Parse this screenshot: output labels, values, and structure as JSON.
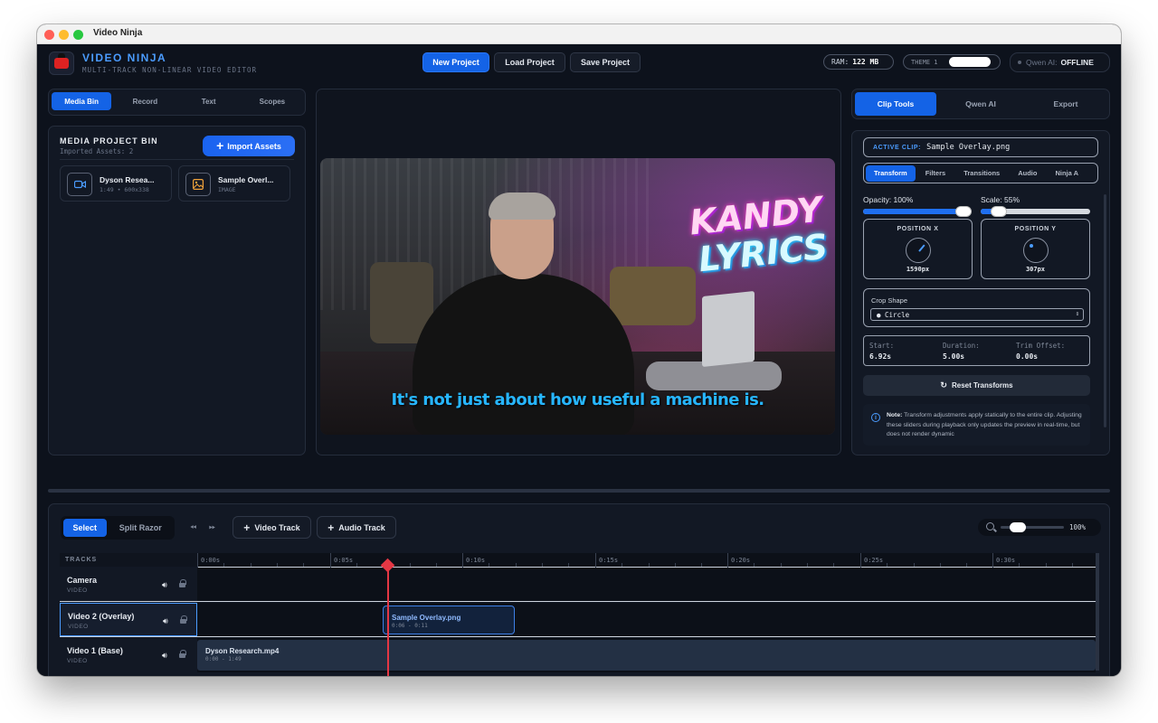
{
  "window": {
    "title": "Video Ninja"
  },
  "header": {
    "app_name": "VIDEO NINJA",
    "app_subtitle": "MULTI-TRACK NON-LINEAR VIDEO EDITOR",
    "new_project": "New Project",
    "load_project": "Load Project",
    "save_project": "Save Project",
    "ram_label": "RAM:",
    "ram_value": "122 MB",
    "theme_label": "THEME 1",
    "qwen_label": "Qwen AI:",
    "qwen_status": "OFFLINE"
  },
  "left_tabs": [
    "Media Bin",
    "Record",
    "Text",
    "Scopes"
  ],
  "media_bin": {
    "title": "MEDIA PROJECT BIN",
    "subtitle": "Imported Assets: 2",
    "import_label": "Import Assets",
    "assets": [
      {
        "name": "Dyson Resea...",
        "meta": "1:49 • 600x338",
        "icon": "video-icon"
      },
      {
        "name": "Sample Overl...",
        "meta": "IMAGE",
        "icon": "image-icon"
      }
    ]
  },
  "viewer": {
    "overlay_line1": "KANDY",
    "overlay_line2": "LYRICS",
    "subtitle": "It's not just about how useful a machine is."
  },
  "right_tabs": [
    "Clip Tools",
    "Qwen AI",
    "Export"
  ],
  "clip_tools": {
    "active_clip_label": "ACTIVE CLIP:",
    "active_clip_name": "Sample Overlay.png",
    "subtabs": [
      "Transform",
      "Filters",
      "Transitions",
      "Audio",
      "Ninja A"
    ],
    "opacity_label": "Opacity: 100%",
    "opacity": 1.0,
    "scale_label": "Scale: 55%",
    "scale": 0.55,
    "position_x_label": "POSITION X",
    "position_x_value": "1590px",
    "position_y_label": "POSITION Y",
    "position_y_value": "307px",
    "crop_label": "Crop Shape",
    "crop_value": "● Circle",
    "start_label": "Start:",
    "start_value": "6.92s",
    "duration_label": "Duration:",
    "duration_value": "5.00s",
    "trim_label": "Trim Offset:",
    "trim_value": "0.00s",
    "reset_label": "Reset Transforms",
    "note_bold": "Note:",
    "note_text": "Transform adjustments apply statically to the entire clip. Adjusting these sliders during playback only updates the preview in real-time, but does not render dynamic"
  },
  "timeline": {
    "tool_select": "Select",
    "tool_split": "Split Razor",
    "add_video": "Video Track",
    "add_audio": "Audio Track",
    "zoom_value": "100%",
    "zoom": 0.2,
    "tracks_header": "TRACKS",
    "ticks": [
      "0:00s",
      "0:05s",
      "0:10s",
      "0:15s",
      "0:20s",
      "0:25s",
      "0:30s"
    ],
    "tracks": [
      {
        "name": "Camera",
        "type": "VIDEO"
      },
      {
        "name": "Video 2 (Overlay)",
        "type": "VIDEO"
      },
      {
        "name": "Video 1 (Base)",
        "type": "VIDEO"
      }
    ],
    "clips": [
      {
        "name": "Sample Overlay.png",
        "time": "0:06 - 0:11"
      },
      {
        "name": "Dyson Research.mp4",
        "time": "0:00 - 1:49"
      }
    ]
  },
  "colors": {
    "accent": "#1463e6",
    "brand": "#4b9cff",
    "playhead": "#e53744"
  }
}
